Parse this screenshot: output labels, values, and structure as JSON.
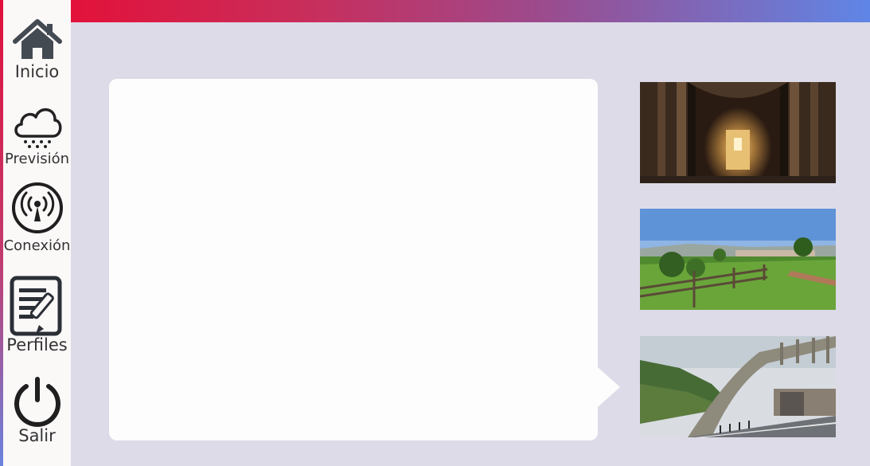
{
  "sidebar": {
    "items": [
      {
        "label": "Inicio",
        "icon": "home-icon"
      },
      {
        "label": "Previsión",
        "icon": "rain-cloud-icon"
      },
      {
        "label": "Conexión",
        "icon": "wireless-signal-icon"
      },
      {
        "label": "Perfiles",
        "icon": "profile-edit-icon"
      },
      {
        "label": "Salir",
        "icon": "power-icon"
      }
    ]
  },
  "gallery": {
    "items": [
      {
        "icon": "cathedral-interior-photo"
      },
      {
        "icon": "park-landscape-photo"
      },
      {
        "icon": "bridge-road-photo"
      }
    ]
  },
  "colors": {
    "background": "#dcdbe7",
    "panel": "#fdfdfd",
    "sidebar": "#fbf8f8",
    "gradient_start": "#e2123a",
    "gradient_end": "#5f86e6"
  }
}
